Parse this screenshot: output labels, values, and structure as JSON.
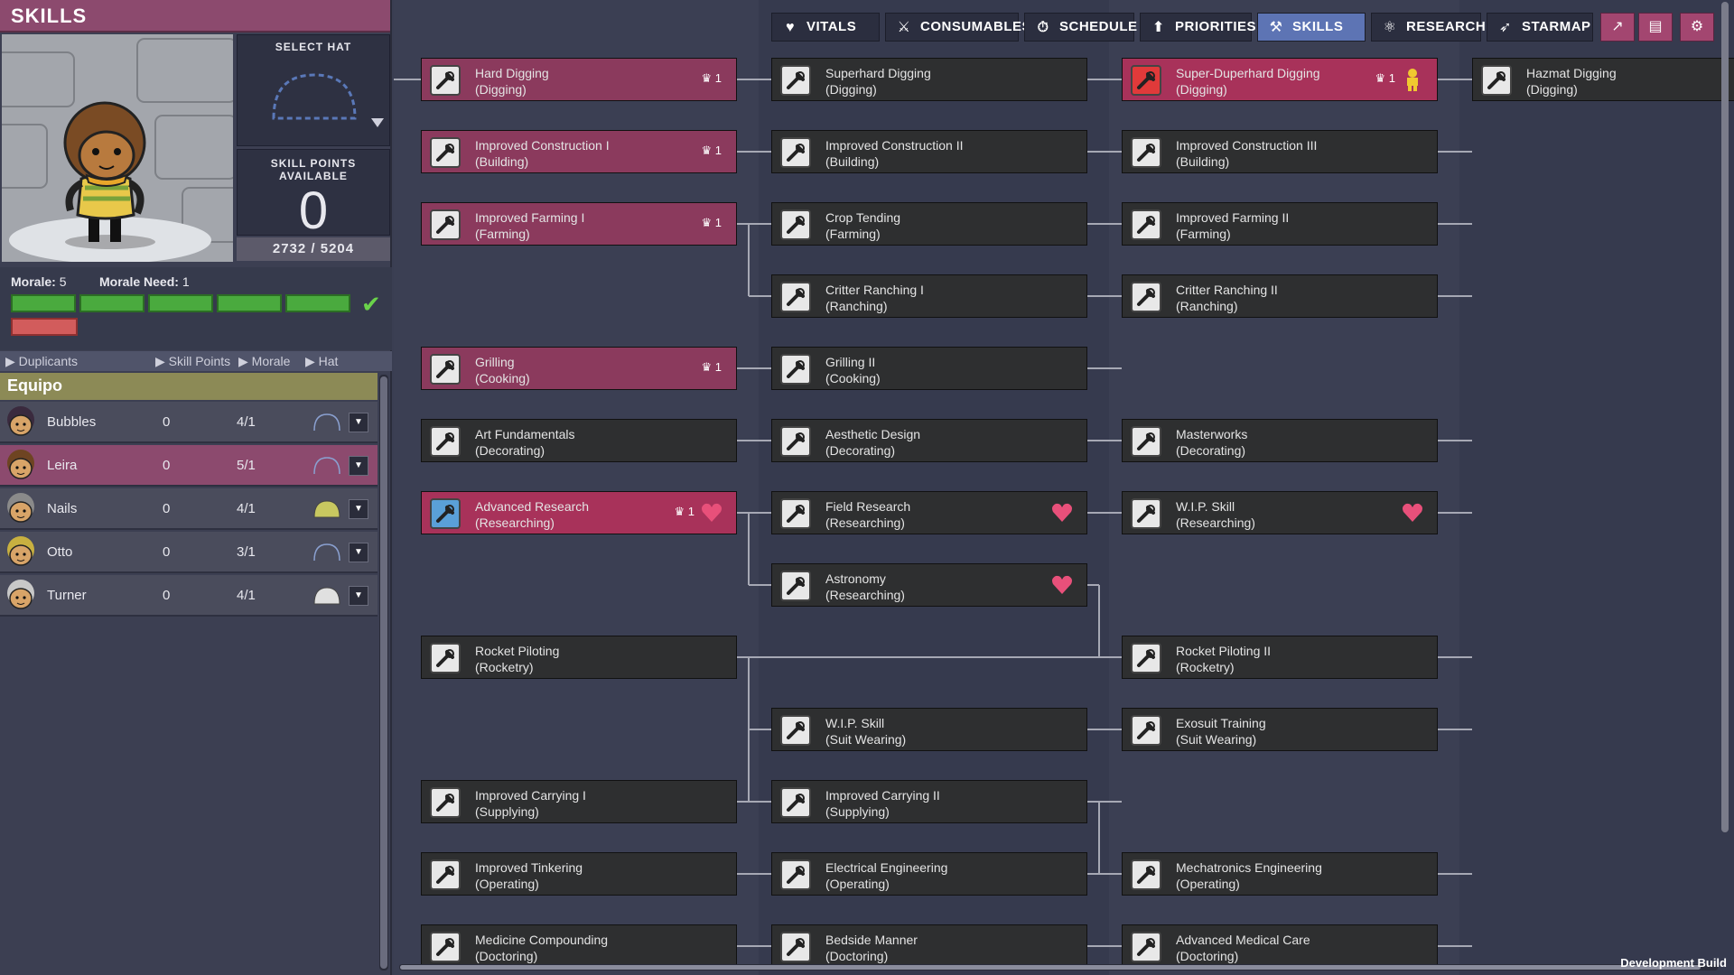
{
  "left": {
    "title": "SKILLS",
    "select_hat": "SELECT HAT",
    "skill_points_label": "SKILL POINTS AVAILABLE",
    "skill_points": "0",
    "xp": "2732 / 5204",
    "morale_label": "Morale:",
    "morale_value": "5",
    "morale_need_label": "Morale Need:",
    "morale_need_value": "1",
    "breadcrumbs": [
      "Duplicants",
      "Skill Points",
      "Morale",
      "Hat"
    ],
    "crew_header": "Equipo",
    "crew": [
      {
        "name": "Bubbles",
        "points": "0",
        "morale": "4/1",
        "selected": false
      },
      {
        "name": "Leira",
        "points": "0",
        "morale": "5/1",
        "selected": true
      },
      {
        "name": "Nails",
        "points": "0",
        "morale": "4/1",
        "selected": false
      },
      {
        "name": "Otto",
        "points": "0",
        "morale": "3/1",
        "selected": false
      },
      {
        "name": "Turner",
        "points": "0",
        "morale": "4/1",
        "selected": false
      }
    ]
  },
  "toolbar": {
    "tabs": [
      {
        "label": "VITALS",
        "icon": "heart-icon",
        "active": false
      },
      {
        "label": "CONSUMABLES",
        "icon": "utensils-icon",
        "active": false
      },
      {
        "label": "SCHEDULE",
        "icon": "stopwatch-icon",
        "active": false
      },
      {
        "label": "PRIORITIES",
        "icon": "priority-icon",
        "active": false
      },
      {
        "label": "SKILLS",
        "icon": "wrench-icon",
        "active": true
      },
      {
        "label": "RESEARCH",
        "icon": "atom-icon",
        "active": false
      },
      {
        "label": "STARMAP",
        "icon": "rocket-icon",
        "active": false
      }
    ],
    "extra_icons": [
      "report-icon",
      "codex-icon",
      "settings-icon"
    ]
  },
  "skills": {
    "rows": [
      [
        {
          "name": "Hard Digging",
          "group": "(Digging)",
          "crown": "1",
          "state": "mastered"
        },
        {
          "name": "Superhard Digging",
          "group": "(Digging)"
        },
        {
          "name": "Super-Duperhard Digging",
          "group": "(Digging)",
          "crown": "1",
          "state": "hl",
          "figure": true
        },
        {
          "name": "Hazmat Digging",
          "group": "(Digging)"
        }
      ],
      [
        {
          "name": "Improved Construction I",
          "group": "(Building)",
          "crown": "1",
          "state": "mastered"
        },
        {
          "name": "Improved Construction II",
          "group": "(Building)"
        },
        {
          "name": "Improved Construction III",
          "group": "(Building)"
        }
      ],
      [
        {
          "name": "Improved Farming I",
          "group": "(Farming)",
          "crown": "1",
          "state": "mastered"
        },
        {
          "name": "Crop Tending",
          "group": "(Farming)"
        },
        {
          "name": "Improved Farming II",
          "group": "(Farming)"
        }
      ],
      [
        null,
        {
          "name": "Critter Ranching I",
          "group": "(Ranching)"
        },
        {
          "name": "Critter Ranching II",
          "group": "(Ranching)"
        }
      ],
      [
        {
          "name": "Grilling",
          "group": "(Cooking)",
          "crown": "1",
          "state": "mastered"
        },
        {
          "name": "Grilling II",
          "group": "(Cooking)"
        }
      ],
      [
        {
          "name": "Art Fundamentals",
          "group": "(Decorating)"
        },
        {
          "name": "Aesthetic Design",
          "group": "(Decorating)"
        },
        {
          "name": "Masterworks",
          "group": "(Decorating)"
        }
      ],
      [
        {
          "name": "Advanced Research",
          "group": "(Researching)",
          "crown": "1",
          "state": "hl",
          "heart": true
        },
        {
          "name": "Field Research",
          "group": "(Researching)",
          "heart": true
        },
        {
          "name": "W.I.P. Skill",
          "group": "(Researching)",
          "heart": true
        }
      ],
      [
        null,
        {
          "name": "Astronomy",
          "group": "(Researching)",
          "heart": true
        }
      ],
      [
        {
          "name": "Rocket Piloting",
          "group": "(Rocketry)"
        },
        null,
        {
          "name": "Rocket Piloting II",
          "group": "(Rocketry)"
        }
      ],
      [
        null,
        {
          "name": "W.I.P. Skill",
          "group": "(Suit Wearing)"
        },
        {
          "name": "Exosuit Training",
          "group": "(Suit Wearing)"
        }
      ],
      [
        {
          "name": "Improved Carrying I",
          "group": "(Supplying)"
        },
        {
          "name": "Improved Carrying II",
          "group": "(Supplying)"
        }
      ],
      [
        {
          "name": "Improved Tinkering",
          "group": "(Operating)"
        },
        {
          "name": "Electrical Engineering",
          "group": "(Operating)"
        },
        {
          "name": "Mechatronics Engineering",
          "group": "(Operating)"
        }
      ],
      [
        {
          "name": "Medicine Compounding",
          "group": "(Doctoring)"
        },
        {
          "name": "Bedside Manner",
          "group": "(Doctoring)"
        },
        {
          "name": "Advanced Medical Care",
          "group": "(Doctoring)"
        }
      ]
    ]
  },
  "footer": {
    "dev_build": "Development Build"
  }
}
